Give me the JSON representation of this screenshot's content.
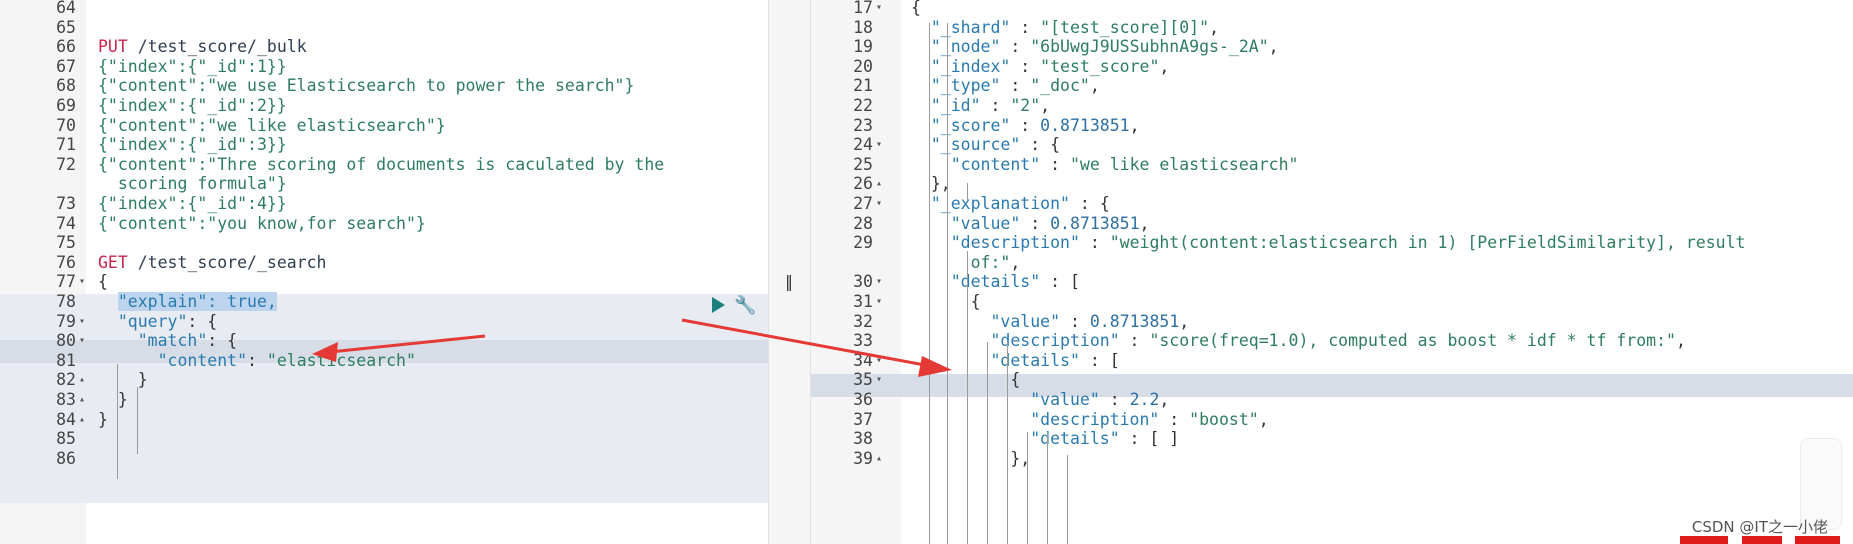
{
  "left_editor": {
    "lines": [
      {
        "n": "64",
        "fold": "",
        "tokens": []
      },
      {
        "n": "65",
        "fold": "",
        "tokens": []
      },
      {
        "n": "66",
        "fold": "",
        "tokens": [
          {
            "t": "PUT",
            "c": "t-method"
          },
          {
            "t": " /test_score/_bulk",
            "c": "t-url"
          }
        ]
      },
      {
        "n": "67",
        "fold": "",
        "tokens": [
          {
            "t": "{\"index\":{\"_id\":1}}",
            "c": "t-str"
          }
        ]
      },
      {
        "n": "68",
        "fold": "",
        "tokens": [
          {
            "t": "{\"content\":\"we use Elasticsearch to power the search\"}",
            "c": "t-str"
          }
        ]
      },
      {
        "n": "69",
        "fold": "",
        "tokens": [
          {
            "t": "{\"index\":{\"_id\":2}}",
            "c": "t-str"
          }
        ]
      },
      {
        "n": "70",
        "fold": "",
        "tokens": [
          {
            "t": "{\"content\":\"we like elasticsearch\"}",
            "c": "t-str"
          }
        ]
      },
      {
        "n": "71",
        "fold": "",
        "tokens": [
          {
            "t": "{\"index\":{\"_id\":3}}",
            "c": "t-str"
          }
        ]
      },
      {
        "n": "72",
        "fold": "",
        "tokens": [
          {
            "t": "{\"content\":\"Thre scoring of documents is caculated by the",
            "c": "t-str"
          }
        ]
      },
      {
        "n": "",
        "fold": "",
        "tokens": [
          {
            "t": "  scoring formula\"}",
            "c": "t-str"
          }
        ]
      },
      {
        "n": "73",
        "fold": "",
        "tokens": [
          {
            "t": "{\"index\":{\"_id\":4}}",
            "c": "t-str"
          }
        ]
      },
      {
        "n": "74",
        "fold": "",
        "tokens": [
          {
            "t": "{\"content\":\"you know,for search\"}",
            "c": "t-str"
          }
        ]
      },
      {
        "n": "75",
        "fold": "",
        "tokens": []
      },
      {
        "n": "76",
        "fold": "",
        "tokens": [
          {
            "t": "GET",
            "c": "t-method"
          },
          {
            "t": " /test_score/_search",
            "c": "t-url"
          }
        ]
      },
      {
        "n": "77",
        "fold": "▾",
        "tokens": [
          {
            "t": "{",
            "c": "t-punc"
          }
        ]
      },
      {
        "n": "78",
        "fold": "",
        "tokens": [
          {
            "t": "  ",
            "c": "t-punc"
          },
          {
            "t": "\"explain\": true,",
            "c": "t-key sel"
          }
        ]
      },
      {
        "n": "79",
        "fold": "▾",
        "tokens": [
          {
            "t": "  ",
            "c": "t-punc"
          },
          {
            "t": "\"query\"",
            "c": "t-key"
          },
          {
            "t": ": {",
            "c": "t-punc"
          }
        ]
      },
      {
        "n": "80",
        "fold": "▾",
        "tokens": [
          {
            "t": "    ",
            "c": "t-punc"
          },
          {
            "t": "\"match\"",
            "c": "t-key"
          },
          {
            "t": ": {",
            "c": "t-punc"
          }
        ]
      },
      {
        "n": "81",
        "fold": "",
        "tokens": [
          {
            "t": "      ",
            "c": "t-punc"
          },
          {
            "t": "\"content\"",
            "c": "t-key"
          },
          {
            "t": ": ",
            "c": "t-punc"
          },
          {
            "t": "\"elasticsearch\"",
            "c": "t-str"
          }
        ]
      },
      {
        "n": "82",
        "fold": "▴",
        "tokens": [
          {
            "t": "    }",
            "c": "t-punc"
          }
        ]
      },
      {
        "n": "83",
        "fold": "▴",
        "tokens": [
          {
            "t": "  }",
            "c": "t-punc"
          }
        ]
      },
      {
        "n": "84",
        "fold": "▴",
        "tokens": [
          {
            "t": "}",
            "c": "t-punc"
          }
        ]
      },
      {
        "n": "85",
        "fold": "",
        "tokens": []
      },
      {
        "n": "86",
        "fold": "",
        "tokens": []
      }
    ]
  },
  "right_editor": {
    "lines": [
      {
        "n": "17",
        "fold": "▾",
        "tokens": [
          {
            "t": "{",
            "c": "t-punc"
          }
        ]
      },
      {
        "n": "18",
        "fold": "",
        "tokens": [
          {
            "t": "  ",
            "c": "t-punc"
          },
          {
            "t": "\"_shard\"",
            "c": "t-key"
          },
          {
            "t": " : ",
            "c": "t-punc"
          },
          {
            "t": "\"[test_score][0]\"",
            "c": "t-str"
          },
          {
            "t": ",",
            "c": "t-punc"
          }
        ]
      },
      {
        "n": "19",
        "fold": "",
        "tokens": [
          {
            "t": "  ",
            "c": "t-punc"
          },
          {
            "t": "\"_node\"",
            "c": "t-key"
          },
          {
            "t": " : ",
            "c": "t-punc"
          },
          {
            "t": "\"6bUwgJ9USSubhnA9gs-_2A\"",
            "c": "t-str"
          },
          {
            "t": ",",
            "c": "t-punc"
          }
        ]
      },
      {
        "n": "20",
        "fold": "",
        "tokens": [
          {
            "t": "  ",
            "c": "t-punc"
          },
          {
            "t": "\"_index\"",
            "c": "t-key"
          },
          {
            "t": " : ",
            "c": "t-punc"
          },
          {
            "t": "\"test_score\"",
            "c": "t-str"
          },
          {
            "t": ",",
            "c": "t-punc"
          }
        ]
      },
      {
        "n": "21",
        "fold": "",
        "tokens": [
          {
            "t": "  ",
            "c": "t-punc"
          },
          {
            "t": "\"_type\"",
            "c": "t-key"
          },
          {
            "t": " : ",
            "c": "t-punc"
          },
          {
            "t": "\"_doc\"",
            "c": "t-str"
          },
          {
            "t": ",",
            "c": "t-punc"
          }
        ]
      },
      {
        "n": "22",
        "fold": "",
        "tokens": [
          {
            "t": "  ",
            "c": "t-punc"
          },
          {
            "t": "\"_id\"",
            "c": "t-key"
          },
          {
            "t": " : ",
            "c": "t-punc"
          },
          {
            "t": "\"2\"",
            "c": "t-str"
          },
          {
            "t": ",",
            "c": "t-punc"
          }
        ]
      },
      {
        "n": "23",
        "fold": "",
        "tokens": [
          {
            "t": "  ",
            "c": "t-punc"
          },
          {
            "t": "\"_score\"",
            "c": "t-key"
          },
          {
            "t": " : ",
            "c": "t-punc"
          },
          {
            "t": "0.8713851",
            "c": "t-num"
          },
          {
            "t": ",",
            "c": "t-punc"
          }
        ]
      },
      {
        "n": "24",
        "fold": "▾",
        "tokens": [
          {
            "t": "  ",
            "c": "t-punc"
          },
          {
            "t": "\"_source\"",
            "c": "t-key"
          },
          {
            "t": " : {",
            "c": "t-punc"
          }
        ]
      },
      {
        "n": "25",
        "fold": "",
        "tokens": [
          {
            "t": "    ",
            "c": "t-punc"
          },
          {
            "t": "\"content\"",
            "c": "t-key"
          },
          {
            "t": " : ",
            "c": "t-punc"
          },
          {
            "t": "\"we like elasticsearch\"",
            "c": "t-str"
          }
        ]
      },
      {
        "n": "26",
        "fold": "▴",
        "tokens": [
          {
            "t": "  },",
            "c": "t-punc"
          }
        ]
      },
      {
        "n": "27",
        "fold": "▾",
        "tokens": [
          {
            "t": "  ",
            "c": "t-punc"
          },
          {
            "t": "\"_explanation\"",
            "c": "t-key"
          },
          {
            "t": " : {",
            "c": "t-punc"
          }
        ]
      },
      {
        "n": "28",
        "fold": "",
        "tokens": [
          {
            "t": "    ",
            "c": "t-punc"
          },
          {
            "t": "\"value\"",
            "c": "t-key"
          },
          {
            "t": " : ",
            "c": "t-punc"
          },
          {
            "t": "0.8713851",
            "c": "t-num"
          },
          {
            "t": ",",
            "c": "t-punc"
          }
        ]
      },
      {
        "n": "29",
        "fold": "",
        "tokens": [
          {
            "t": "    ",
            "c": "t-punc"
          },
          {
            "t": "\"description\"",
            "c": "t-key"
          },
          {
            "t": " : ",
            "c": "t-punc"
          },
          {
            "t": "\"weight(content:elasticsearch in 1) [PerFieldSimilarity], result",
            "c": "t-str"
          }
        ]
      },
      {
        "n": "",
        "fold": "",
        "tokens": [
          {
            "t": "      of:\"",
            "c": "t-str"
          },
          {
            "t": ",",
            "c": "t-punc"
          }
        ]
      },
      {
        "n": "30",
        "fold": "▾",
        "tokens": [
          {
            "t": "    ",
            "c": "t-punc"
          },
          {
            "t": "\"details\"",
            "c": "t-key"
          },
          {
            "t": " : [",
            "c": "t-punc"
          }
        ]
      },
      {
        "n": "31",
        "fold": "▾",
        "tokens": [
          {
            "t": "      {",
            "c": "t-punc"
          }
        ]
      },
      {
        "n": "32",
        "fold": "",
        "tokens": [
          {
            "t": "        ",
            "c": "t-punc"
          },
          {
            "t": "\"value\"",
            "c": "t-key"
          },
          {
            "t": " : ",
            "c": "t-punc"
          },
          {
            "t": "0.8713851",
            "c": "t-num"
          },
          {
            "t": ",",
            "c": "t-punc"
          }
        ]
      },
      {
        "n": "33",
        "fold": "",
        "tokens": [
          {
            "t": "        ",
            "c": "t-punc"
          },
          {
            "t": "\"description\"",
            "c": "t-key"
          },
          {
            "t": " : ",
            "c": "t-punc"
          },
          {
            "t": "\"score(freq=1.0), computed as boost * idf * tf from:\"",
            "c": "t-str"
          },
          {
            "t": ",",
            "c": "t-punc"
          }
        ]
      },
      {
        "n": "34",
        "fold": "▾",
        "tokens": [
          {
            "t": "        ",
            "c": "t-punc"
          },
          {
            "t": "\"details\"",
            "c": "t-key"
          },
          {
            "t": " : [",
            "c": "t-punc"
          }
        ]
      },
      {
        "n": "35",
        "fold": "▾",
        "tokens": [
          {
            "t": "          {",
            "c": "t-punc"
          }
        ]
      },
      {
        "n": "36",
        "fold": "",
        "tokens": [
          {
            "t": "            ",
            "c": "t-punc"
          },
          {
            "t": "\"value\"",
            "c": "t-key"
          },
          {
            "t": " : ",
            "c": "t-punc"
          },
          {
            "t": "2.2",
            "c": "t-num"
          },
          {
            "t": ",",
            "c": "t-punc"
          }
        ]
      },
      {
        "n": "37",
        "fold": "",
        "tokens": [
          {
            "t": "            ",
            "c": "t-punc"
          },
          {
            "t": "\"description\"",
            "c": "t-key"
          },
          {
            "t": " : ",
            "c": "t-punc"
          },
          {
            "t": "\"boost\"",
            "c": "t-str"
          },
          {
            "t": ",",
            "c": "t-punc"
          }
        ]
      },
      {
        "n": "38",
        "fold": "",
        "tokens": [
          {
            "t": "            ",
            "c": "t-punc"
          },
          {
            "t": "\"details\"",
            "c": "t-key"
          },
          {
            "t": " : [ ]",
            "c": "t-punc"
          }
        ]
      },
      {
        "n": "39",
        "fold": "▴",
        "tokens": [
          {
            "t": "          },",
            "c": "t-punc"
          }
        ]
      }
    ]
  },
  "icons": {
    "run": "play-icon",
    "settings": "wrench-icon",
    "divider": "resize-handle-icon"
  },
  "colors": {
    "arrow": "#e53935",
    "selection": "#bcd4ee",
    "active_line": "#d6dde7",
    "request_block": "#e8ecf2"
  },
  "watermark": "CSDN @IT之一小佬"
}
